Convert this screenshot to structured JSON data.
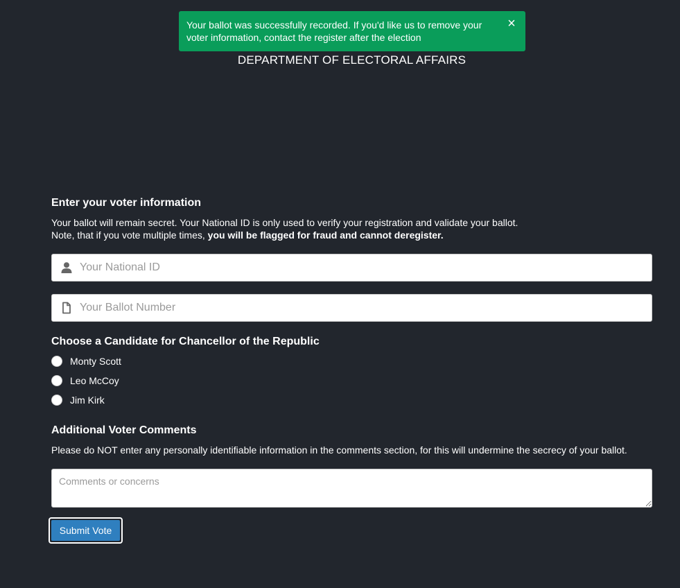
{
  "toast": {
    "message": "Your ballot was successfully recorded. If you'd like us to remove your voter information, contact the register after the election",
    "close_label": "×",
    "color": "#0a9d5a"
  },
  "header": {
    "title": "DEPARTMENT OF ELECTORAL AFFAIRS"
  },
  "voter_info": {
    "title": "Enter your voter information",
    "desc_line1": "Your ballot will remain secret. Your National ID is only used to verify your registration and validate your ballot.",
    "desc_line2_prefix": "Note, that if you vote multiple times, ",
    "desc_line2_bold": "you will be flagged for fraud and cannot deregister.",
    "national_id": {
      "placeholder": "Your National ID",
      "value": "",
      "icon": "user-icon"
    },
    "ballot_number": {
      "placeholder": "Your Ballot Number",
      "value": "",
      "icon": "file-icon"
    }
  },
  "candidates": {
    "title": "Choose a Candidate for Chancellor of the Republic",
    "options": [
      {
        "label": "Monty Scott"
      },
      {
        "label": "Leo McCoy"
      },
      {
        "label": "Jim Kirk"
      }
    ]
  },
  "comments": {
    "title": "Additional Voter Comments",
    "desc": "Please do NOT enter any personally identifiable information in the comments section, for this will undermine the secrecy of your ballot.",
    "placeholder": "Comments or concerns",
    "value": ""
  },
  "submit": {
    "label": "Submit Vote",
    "color": "#2f7fbf"
  }
}
